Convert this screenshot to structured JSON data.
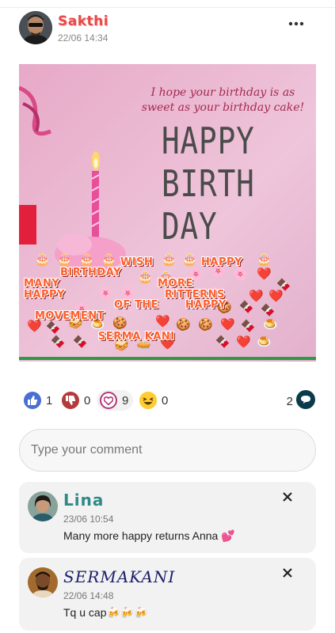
{
  "post": {
    "author": "Sakthi",
    "time": "22/06 14:34",
    "more_icon": "more-horizontal-icon",
    "image": {
      "quote": "I hope your birthday is as sweet as your birthday cake!",
      "title_lines": [
        "HAPPY",
        "BIRTH",
        "DAY"
      ],
      "stickers": [
        "WISH",
        "HAPPY",
        "BIRTHDAY",
        "MANY",
        "MORE",
        "HAPPY",
        "RITTERNS",
        "OF THE",
        "HAPPY",
        "MOVEMENT",
        "SERMA KANI"
      ]
    }
  },
  "reactions": {
    "like": {
      "icon": "thumbs-up-icon",
      "count": "1",
      "color": "#4a6fd1"
    },
    "dislike": {
      "icon": "thumbs-down-icon",
      "count": "0",
      "color": "#b23b3b"
    },
    "love": {
      "icon": "heart-icon",
      "count": "9",
      "color": "#b3387a"
    },
    "laugh": {
      "icon": "laughing-emoji-icon",
      "count": "0"
    },
    "comments": {
      "icon": "chat-bubble-icon",
      "count": "2",
      "color": "#0b3a4a"
    }
  },
  "comment_input": {
    "placeholder": "Type your comment"
  },
  "comments": [
    {
      "name": "Lina",
      "time": "23/06 10:54",
      "text": "Many more happy returns Anna 💕",
      "name_color": "#2f8a86"
    },
    {
      "name": "SERMAKANI",
      "time": "22/06 14:48",
      "text": "Tq u cap🍻🍻🍻",
      "name_color": "#1b1f6b"
    }
  ]
}
